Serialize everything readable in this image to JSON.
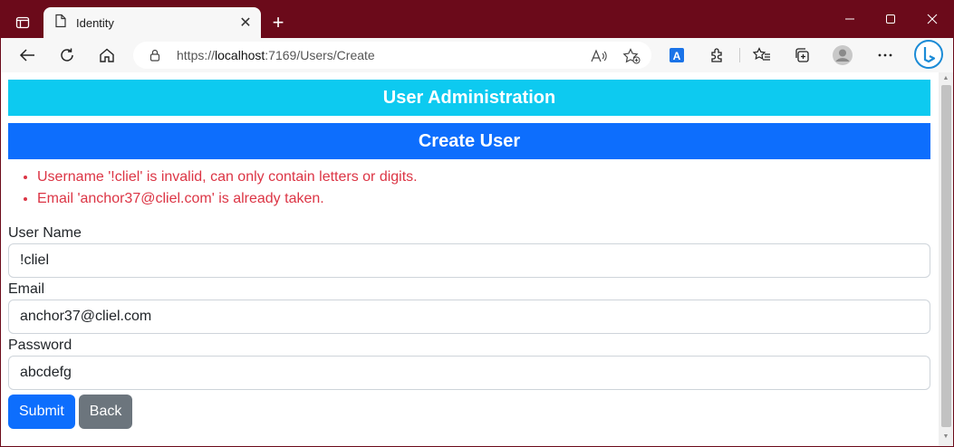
{
  "browser": {
    "tab": {
      "title": "Identity"
    },
    "address": {
      "scheme": "https://",
      "host": "localhost",
      "rest": ":7169/Users/Create"
    }
  },
  "page": {
    "banner_title": "User Administration",
    "section_title": "Create User",
    "errors": [
      "Username '!cliel' is invalid, can only contain letters or digits.",
      "Email 'anchor37@cliel.com' is already taken."
    ],
    "form": {
      "username_label": "User Name",
      "username_value": "!cliel",
      "email_label": "Email",
      "email_value": "anchor37@cliel.com",
      "password_label": "Password",
      "password_value": "abcdefg"
    },
    "submit_label": "Submit",
    "back_label": "Back"
  },
  "colors": {
    "titlebar": "#6b0a1a",
    "banner_info": "#0dcaf0",
    "banner_primary": "#0d6efd",
    "error_text": "#dc3545",
    "btn_secondary": "#6c757d"
  }
}
